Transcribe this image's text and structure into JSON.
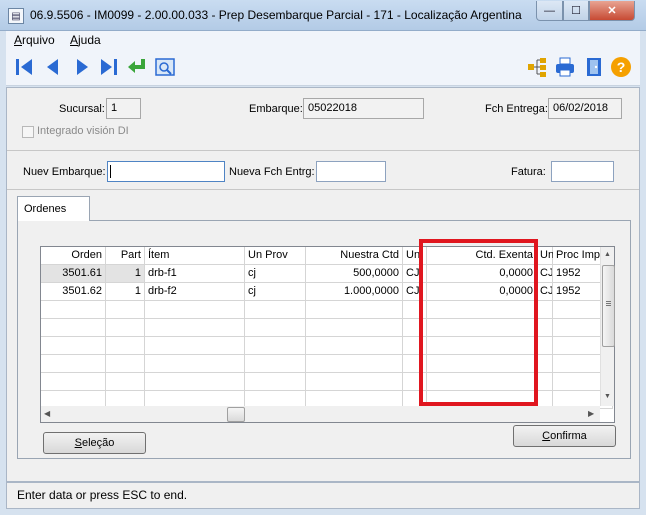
{
  "window": {
    "title": "06.9.5506 - IM0099 - 2.00.00.033 - Prep Desembarque Parcial - 171 - Localização Argentina",
    "controls": {
      "minimize": "—",
      "maximize": "☐",
      "close": "✕"
    }
  },
  "menu": {
    "items": [
      {
        "first": "A",
        "rest": "rquivo"
      },
      {
        "first": "A",
        "rest": "juda"
      }
    ]
  },
  "toolbar": {
    "icons": [
      "first-record-icon",
      "previous-record-icon",
      "next-record-icon",
      "last-record-icon",
      "return-icon",
      "preview-icon",
      "tree-icon",
      "print-icon",
      "exit-door-icon",
      "help-icon"
    ],
    "help_glyph": "?"
  },
  "header": {
    "sucursal_label": "Sucursal:",
    "sucursal_value": "1",
    "embarque_label": "Embarque:",
    "embarque_value": "05022018",
    "fch_entrega_label": "Fch Entrega:",
    "fch_entrega_value": "06/02/2018",
    "integrado_label": "Integrado visión DI"
  },
  "inputs": {
    "nuev_embarque_label": "Nuev Embarque:",
    "nuev_embarque_value": "",
    "nueva_fch_label": "Nueva Fch Entrg:",
    "nueva_fch_value": "",
    "fatura_label": "Fatura:",
    "fatura_value": ""
  },
  "tabs": {
    "ordenes": "Ordenes"
  },
  "grid": {
    "columns": [
      "Orden",
      "Part",
      "Ítem",
      "Un Prov",
      "Nuestra Ctd",
      "Un",
      "Ctd. Exenta",
      "Un",
      "Proc Imp"
    ],
    "rows": [
      [
        "3501.61",
        "1",
        "drb-f1",
        "cj",
        "500,0000",
        "CJ",
        "0,0000",
        "CJ",
        "1952"
      ],
      [
        "3501.62",
        "1",
        "drb-f2",
        "cj",
        "1.000,0000",
        "CJ",
        "0,0000",
        "CJ",
        "1952"
      ]
    ]
  },
  "buttons": {
    "selecao_u": "S",
    "selecao_rest": "eleção",
    "confirma_u": "C",
    "confirma_rest": "onfirma"
  },
  "status": {
    "text": "Enter data or press ESC to end."
  },
  "colors": {
    "highlight_box": "#e0161f",
    "toolbar_blue": "#2a6ad3"
  }
}
